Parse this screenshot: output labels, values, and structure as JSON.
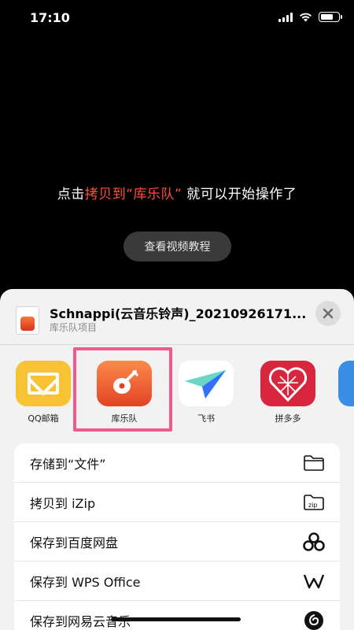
{
  "status_bar": {
    "time": "17:10"
  },
  "instruction": {
    "prefix": "点击",
    "highlight": "拷贝到“库乐队”",
    "suffix": "就可以开始操作了"
  },
  "tutorial_button": {
    "label": "查看视频教程"
  },
  "share_sheet": {
    "file_title": "Schnappi(云音乐铃声)_20210926171...",
    "file_subtitle": "库乐队项目",
    "apps": [
      {
        "label": "QQ邮箱",
        "icon": "qq-mail-icon"
      },
      {
        "label": "库乐队",
        "icon": "garageband-icon"
      },
      {
        "label": "飞书",
        "icon": "feishu-icon"
      },
      {
        "label": "拼多多",
        "icon": "pinduoduo-icon"
      }
    ],
    "actions": [
      {
        "label": "存储到“文件”",
        "icon": "folder-icon"
      },
      {
        "label": "拷贝到 iZip",
        "icon": "zip-folder-icon"
      },
      {
        "label": "保存到百度网盘",
        "icon": "baidu-netdisk-icon"
      },
      {
        "label": "保存到 WPS Office",
        "icon": "wps-icon"
      },
      {
        "label": "保存到网易云音乐",
        "icon": "netease-music-icon"
      }
    ]
  },
  "colors": {
    "highlight_text": "#ff4d3c",
    "highlight_box": "#ee5b8f"
  }
}
